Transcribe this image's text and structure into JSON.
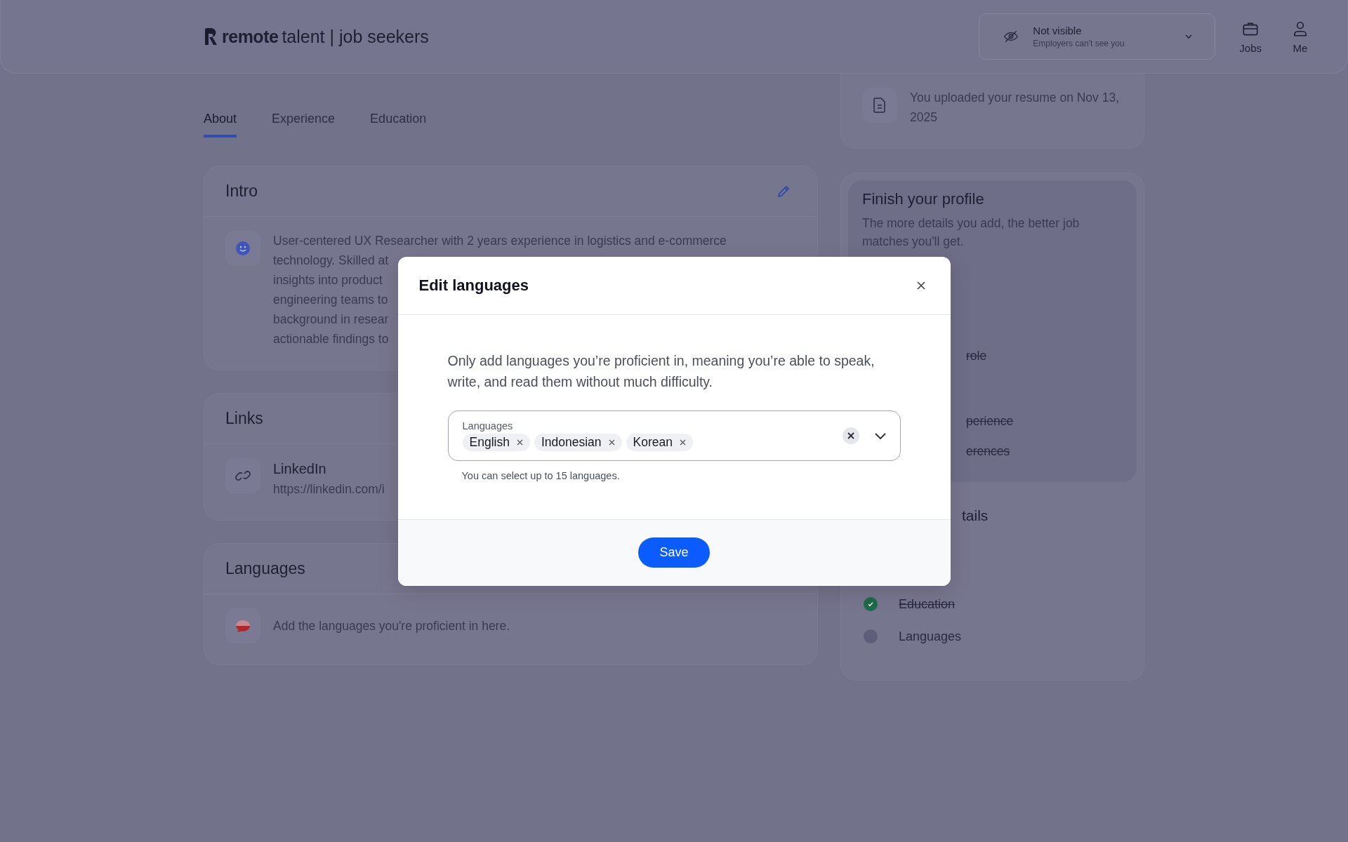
{
  "header": {
    "logo": {
      "brand": "remote",
      "tagline": "talent | job seekers"
    },
    "visibility": {
      "title": "Not visible",
      "subtitle": "Employers can't see you"
    },
    "nav": [
      {
        "label": "Jobs"
      },
      {
        "label": "Me"
      }
    ]
  },
  "tabs": [
    {
      "label": "About",
      "selected": true
    },
    {
      "label": "Experience",
      "selected": false
    },
    {
      "label": "Education",
      "selected": false
    }
  ],
  "intro": {
    "title": "Intro",
    "lines": [
      "User-centered UX Researcher with 2 years experience in logistics and e-commerce",
      "technology. Skilled at",
      "insights into product",
      "engineering teams to",
      "background in resear",
      "actionable findings to"
    ]
  },
  "links": {
    "title": "Links",
    "items": [
      {
        "name": "LinkedIn",
        "url": "https://linkedin.com/i"
      }
    ]
  },
  "languages": {
    "title": "Languages",
    "empty": "Add the languages you're proficient in here."
  },
  "resume": {
    "text": "You uploaded your resume on Nov 13, 2025"
  },
  "profile": {
    "title": "Finish your profile",
    "description": "The more details you add, the better job matches you'll get.",
    "items": [
      {
        "kind": "fragment",
        "label": "role",
        "done": true
      },
      {
        "kind": "fragment",
        "label": "perience",
        "done": true
      },
      {
        "kind": "fragment",
        "label": "erences",
        "done": true
      }
    ]
  },
  "details": {
    "title": "tails",
    "items": [
      {
        "kind": "check",
        "label": "Education",
        "done": true
      },
      {
        "kind": "check",
        "label": "Languages",
        "done": false
      }
    ]
  },
  "modal": {
    "title": "Edit languages",
    "description": "Only add languages you’re proficient in, meaning you’re able to speak, write, and read them without much difficulty.",
    "field": {
      "label": "Languages",
      "chips": [
        "English",
        "Indonesian",
        "Korean"
      ],
      "helper": "You can select up to 15 languages."
    },
    "save": "Save"
  }
}
